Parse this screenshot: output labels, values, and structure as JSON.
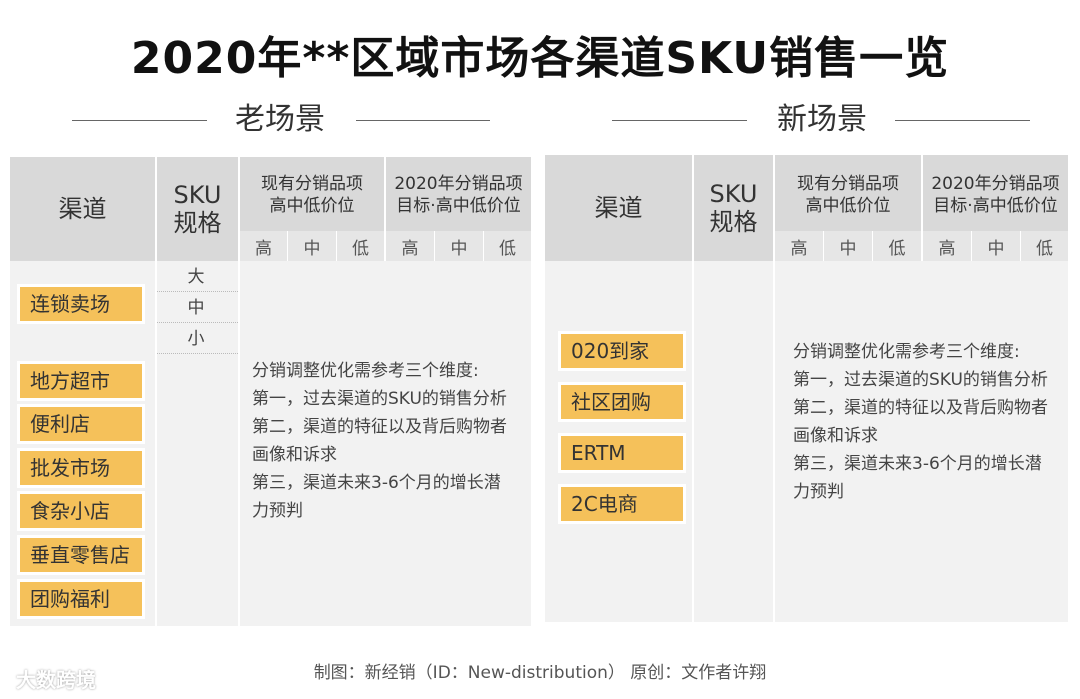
{
  "title": "2020年**区域市场各渠道SKU销售一览",
  "old_scene": {
    "label": "老场景",
    "headers": {
      "channel": "渠道",
      "sku_1": "SKU",
      "sku_2": "规格",
      "current_1": "现有分销品项",
      "current_2": "高中低价位",
      "target_1": "2020年分销品项",
      "target_2": "目标·高中低价位",
      "high": "高",
      "mid": "中",
      "low": "低"
    },
    "sku_sizes": [
      "大",
      "中",
      "小"
    ],
    "channels": [
      "连锁卖场",
      "地方超市",
      "便利店",
      "批发市场",
      "食杂小店",
      "垂直零售店",
      "团购福利"
    ],
    "description": [
      "分销调整优化需参考三个维度:",
      "第一，过去渠道的SKU的销售分析",
      "第二，渠道的特征以及背后购物者",
      "画像和诉求",
      "第三，渠道未来3-6个月的增长潜",
      "力预判"
    ]
  },
  "new_scene": {
    "label": "新场景",
    "headers": {
      "channel": "渠道",
      "sku_1": "SKU",
      "sku_2": "规格",
      "current_1": "现有分销品项",
      "current_2": "高中低价位",
      "target_1": "2020年分销品项",
      "target_2": "目标·高中低价位",
      "high": "高",
      "mid": "中",
      "low": "低"
    },
    "channels": [
      "020到家",
      "社区团购",
      "ERTM",
      "2C电商"
    ],
    "description": [
      "分销调整优化需参考三个维度:",
      "第一，过去渠道的SKU的销售分析",
      "第二，渠道的特征以及背后购物者",
      "画像和诉求",
      "第三，渠道未来3-6个月的增长潜",
      "力预判"
    ]
  },
  "footer": "制图：新经销（ID：New-distribution） 原创：文作者许翔",
  "watermark": "大数跨境",
  "colors": {
    "chip": "#f5c15a",
    "header": "#d9d9d9",
    "panel": "#f2f2f2"
  }
}
